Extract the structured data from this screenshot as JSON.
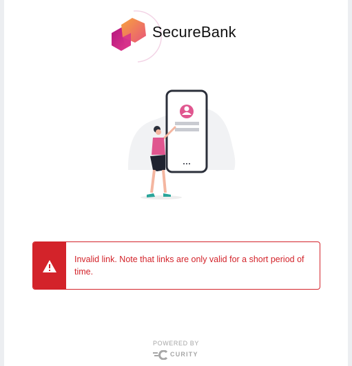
{
  "brand": {
    "name": "SecureBank",
    "logo_icon": "hexagon-logo-icon",
    "colors": {
      "pink": "#d6338c",
      "orange": "#f7a33d",
      "magenta": "#c21f8a"
    }
  },
  "illustration": {
    "icon": "phone-user-illustration"
  },
  "alert": {
    "icon": "warning-icon",
    "message": "Invalid link. Note that links are only valid for a short period of time.",
    "color": "#d3232a"
  },
  "footer": {
    "powered_by": "POWERED BY",
    "vendor": "CURITY",
    "vendor_icon": "curity-logo-icon"
  }
}
